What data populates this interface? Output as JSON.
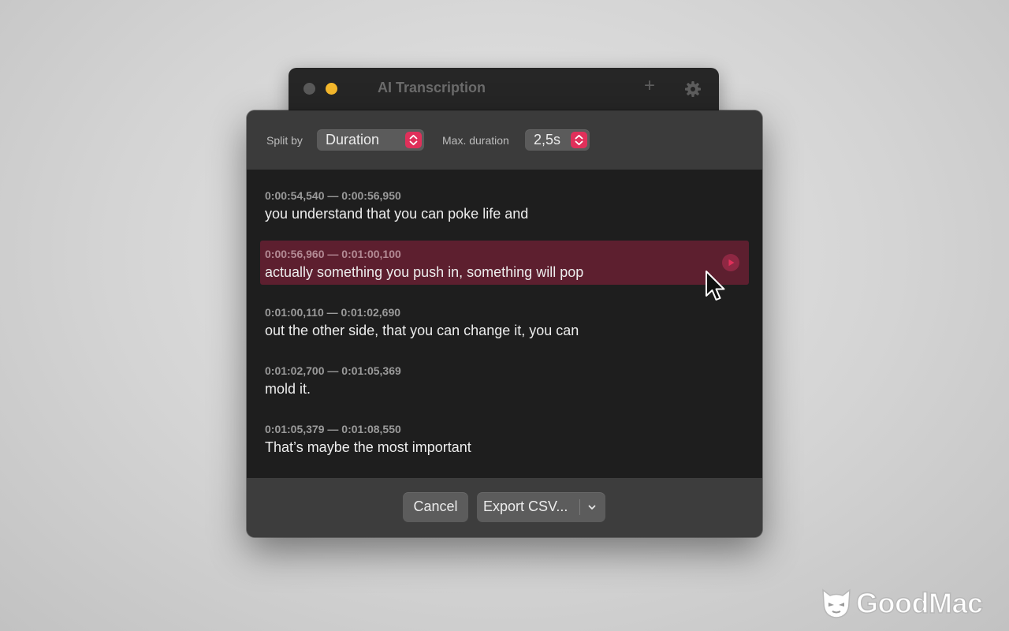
{
  "background_window": {
    "title": "AI Transcription",
    "icons": [
      "plus-icon",
      "gear-icon"
    ]
  },
  "toolbar": {
    "split_by_label": "Split by",
    "split_by_value": "Duration",
    "max_duration_label": "Max. duration",
    "max_duration_value": "2,5s"
  },
  "segments": [
    {
      "time": "0:00:54,540 — 0:00:56,950",
      "text": "you understand that you can poke life and"
    },
    {
      "time": "0:00:56,960 — 0:01:00,100",
      "text": "actually something you push in, something will pop",
      "highlighted": true
    },
    {
      "time": "0:01:00,110 — 0:01:02,690",
      "text": "out the other side, that you can change it, you can"
    },
    {
      "time": "0:01:02,700 — 0:01:05,369",
      "text": "mold it."
    },
    {
      "time": "0:01:05,379 — 0:01:08,550",
      "text": "That’s maybe the most important"
    }
  ],
  "footer": {
    "cancel_label": "Cancel",
    "export_label": "Export CSV..."
  },
  "watermark": {
    "text": "GoodMac"
  },
  "colors": {
    "accent": "#e0305a",
    "highlight_row": "#5d1f2f",
    "list_background": "#1e1e1e",
    "panel_background": "#3a3a3a"
  }
}
